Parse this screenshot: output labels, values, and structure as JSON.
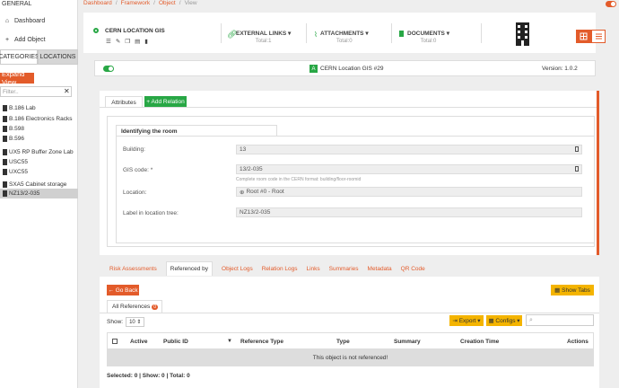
{
  "sidebar": {
    "general": "GENERAL",
    "dashboard": "Dashboard",
    "add_object": "Add Object",
    "tabs": [
      "CATEGORIES",
      "LOCATIONS"
    ],
    "expand_view": "Expand View",
    "filter_placeholder": "Filter..",
    "locations": [
      {
        "label": "B.186 Lab"
      },
      {
        "label": "B.186 Electronics Racks"
      },
      {
        "label": "B.598"
      },
      {
        "label": "B.596"
      },
      {
        "label": "UX5 RP Buffer Zone Lab"
      },
      {
        "label": "USC55"
      },
      {
        "label": "UXC55"
      },
      {
        "label": "SXA5 Cabinet storage"
      },
      {
        "label": "NZ13/2-035"
      }
    ]
  },
  "breadcrumb": [
    "Dashboard",
    "Framework",
    "Object",
    "View"
  ],
  "header": {
    "title": "CERN LOCATION GIS",
    "external_links": {
      "label": "EXTERNAL LINKS",
      "total": "Total:1"
    },
    "attachments": {
      "label": "ATTACHMENTS",
      "total": "Total:0"
    },
    "documents": {
      "label": "DOCUMENTS",
      "total": "Total:0"
    }
  },
  "status": {
    "object_name": "CERN Location GIS #29",
    "version": "Version: 1.0.2"
  },
  "attributes": {
    "tab": "Attributes",
    "add_relation": "+ Add Relation",
    "section_title": "Identifying the room",
    "fields": [
      {
        "label": "Building:",
        "value": "13"
      },
      {
        "label": "GIS code: *",
        "value": "13/2-035",
        "help": "Complete room code in the CERN format: building/floor-roomid"
      },
      {
        "label": "Location:",
        "value": "Root #0 - Root"
      },
      {
        "label": "Label in location tree:",
        "value": "NZ13/2-035"
      }
    ]
  },
  "bottom": {
    "tabs": [
      "Risk Assessments",
      "Referenced by",
      "Object Logs",
      "Relation Logs",
      "Links",
      "Summaries",
      "Metadata",
      "QR Code"
    ],
    "go_back": "Go Back",
    "show_tabs": "Show Tabs",
    "all_references": "All References",
    "references_count": "0",
    "show_label": "Show:",
    "show_value": "10",
    "export": "Export",
    "configs": "Configs",
    "columns": [
      "Active",
      "Public ID",
      "Reference Type",
      "Type",
      "Summary",
      "Creation Time",
      "Actions"
    ],
    "empty_message": "This object is not referenced!",
    "footer": "Selected: 0 | Show: 0 | Total: 0"
  },
  "colors": {
    "accent": "#e35b2a",
    "green": "#28a745",
    "yellow": "#f4b400"
  }
}
